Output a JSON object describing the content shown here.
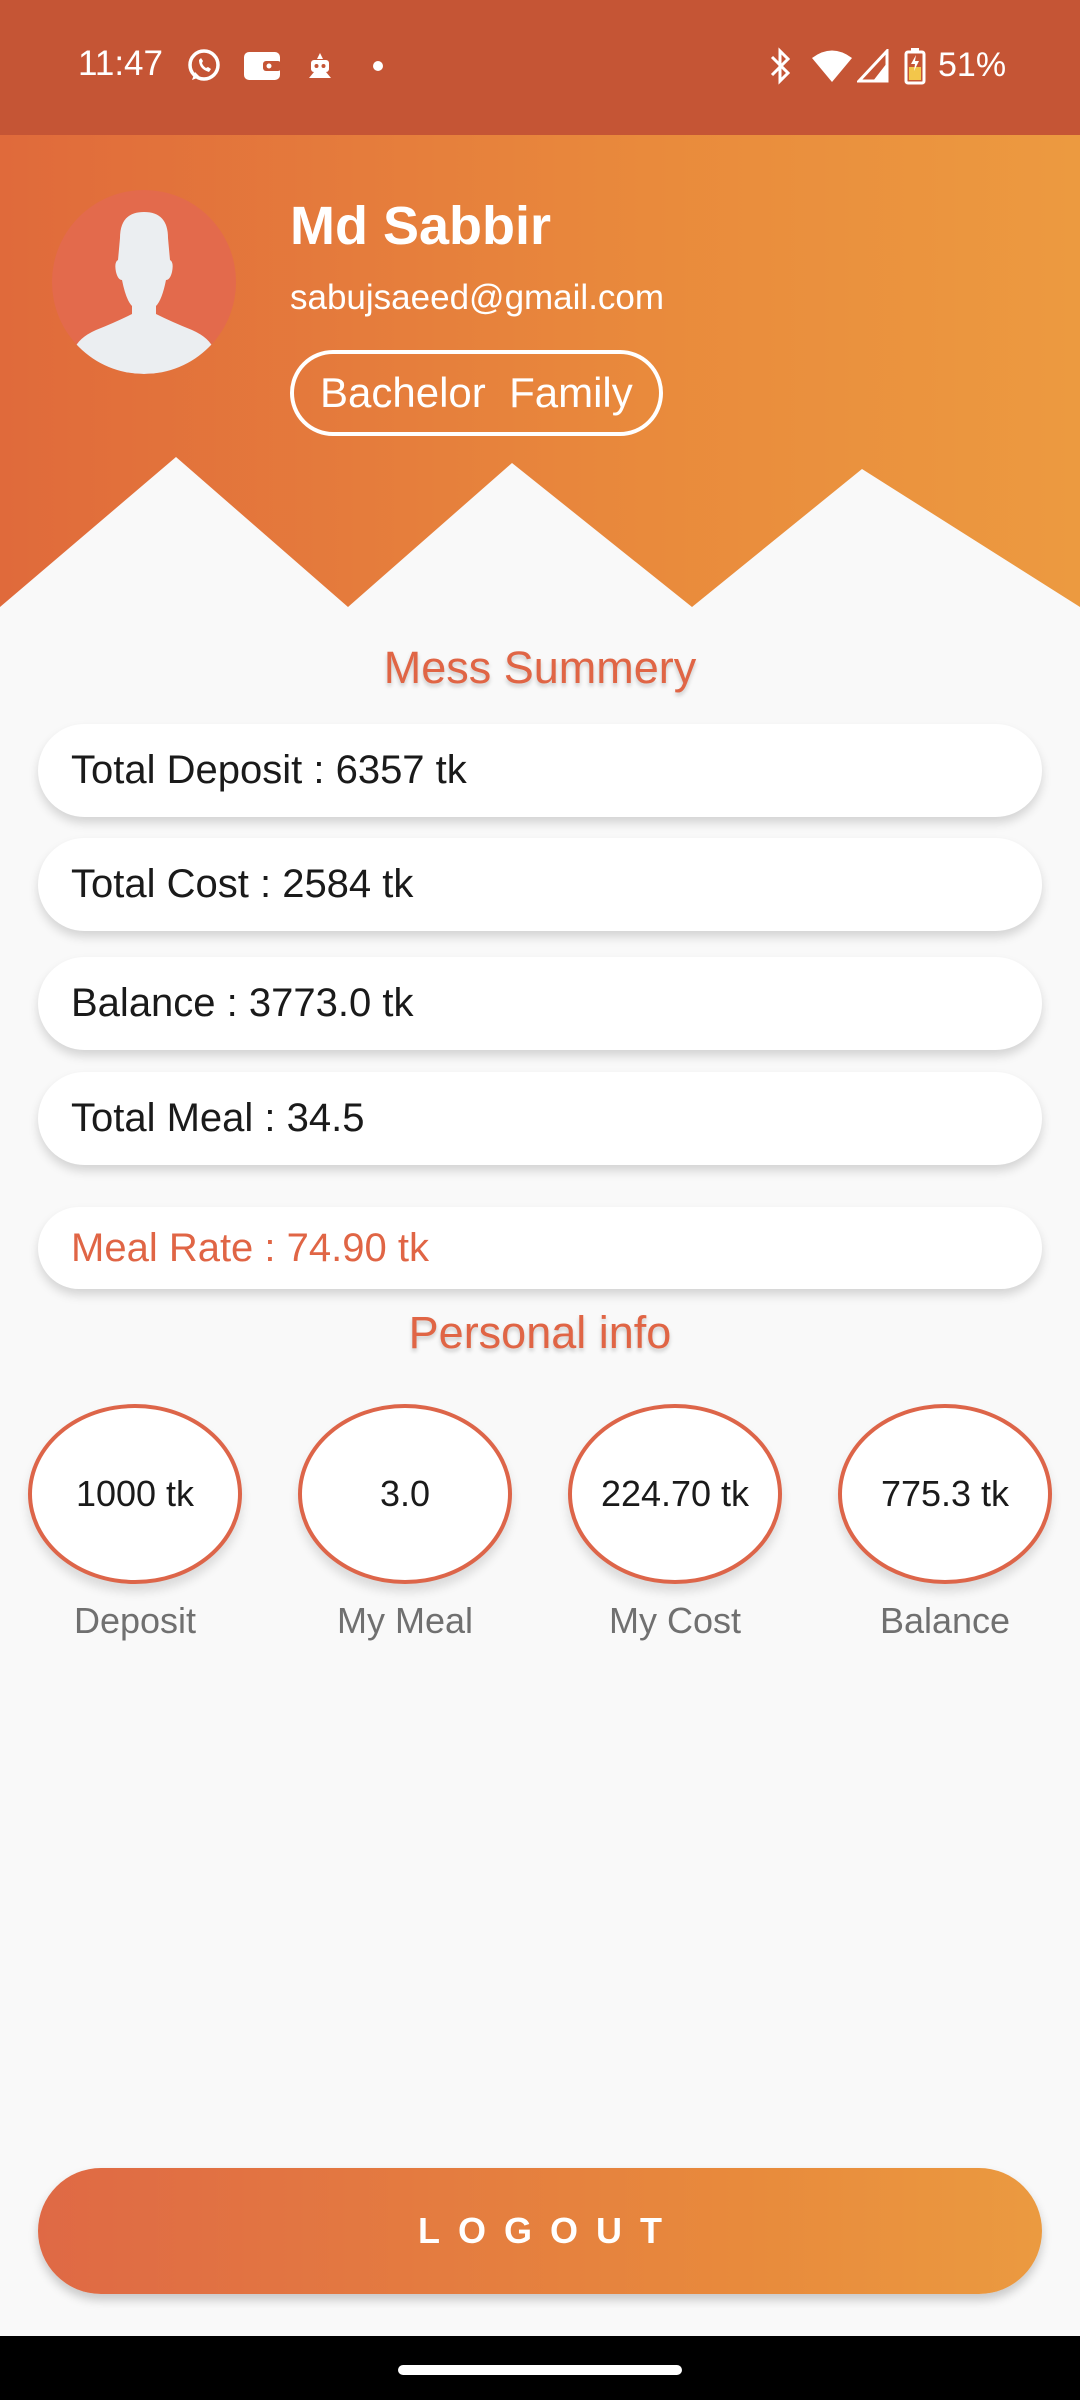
{
  "status_bar": {
    "time": "11:47",
    "battery": "51%"
  },
  "profile": {
    "name": "Md Sabbir",
    "email": "sabujsaeed@gmail.com",
    "mess_type": "Bachelor  Family"
  },
  "summary": {
    "title": "Mess Summery",
    "total_deposit": "Total Deposit : 6357 tk",
    "total_cost": "Total Cost : 2584 tk",
    "balance": "Balance : 3773.0 tk",
    "total_meal": "Total Meal : 34.5",
    "meal_rate": "Meal Rate : 74.90 tk"
  },
  "personal": {
    "title": "Personal info",
    "items": [
      {
        "value": "1000 tk",
        "label": "Deposit"
      },
      {
        "value": "3.0",
        "label": "My Meal"
      },
      {
        "value": "224.70 tk",
        "label": "My Cost"
      },
      {
        "value": "775.3 tk",
        "label": "Balance"
      }
    ]
  },
  "logout_label": "LOGOUT",
  "colors": {
    "status_bar": "#c55535",
    "accent": "#e06545",
    "gradient_start": "#e06a3b",
    "gradient_end": "#ec9a40"
  },
  "icons": {
    "status": [
      "whatsapp-icon",
      "wallet-icon",
      "bot-icon",
      "dot-icon",
      "bluetooth-icon",
      "wifi-icon",
      "signal-icon",
      "battery-icon"
    ],
    "avatar": "person-silhouette-icon"
  }
}
